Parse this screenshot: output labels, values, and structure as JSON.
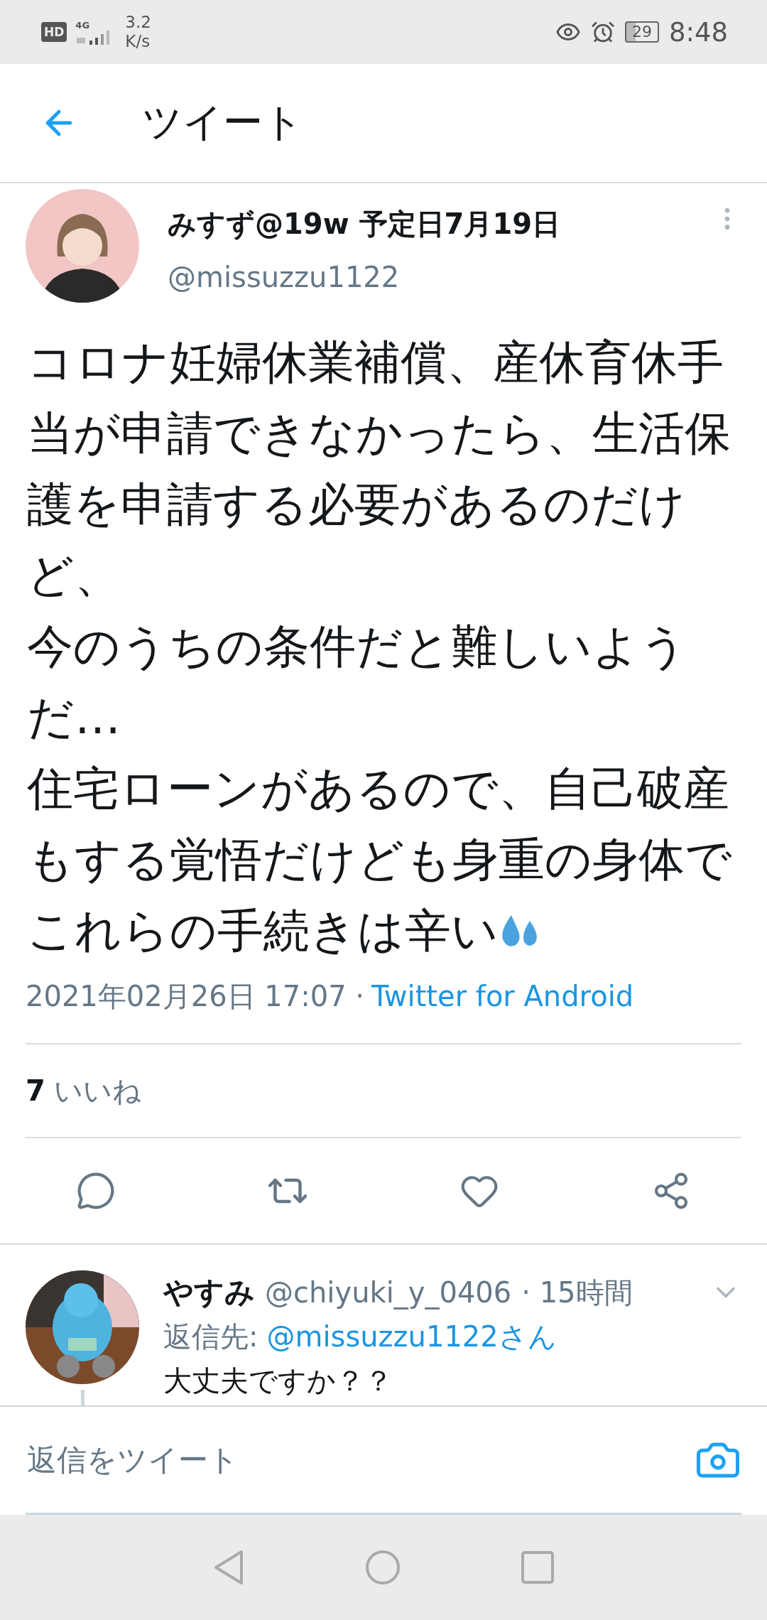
{
  "status_bar": {
    "network_badge": "HD",
    "network_type": "4G",
    "speed_value": "3.2",
    "speed_unit": "K/s",
    "battery": "29",
    "time": "8:48"
  },
  "header": {
    "title": "ツイート"
  },
  "tweet": {
    "author": {
      "name": "みすず@19w 予定日7月19日",
      "handle": "@missuzzu1122"
    },
    "paragraphs": [
      "コロナ妊婦休業補償、産休育休手当が申請できなかったら、生活保護を申請する必要があるのだけど、",
      "今のうちの条件だと難しいようだ…",
      "住宅ローンがあるので、自己破産もする覚悟だけども身重の身体でこれらの手続きは辛い"
    ],
    "timestamp": "2021年02月26日 17:07 ·",
    "source": "Twitter for Android",
    "likes": {
      "count": "7",
      "label": "いいね"
    },
    "liked": false
  },
  "reply": {
    "name": "やすみ",
    "handle": "@chiyuki_y_0406",
    "time": "· 15時間",
    "reply_to_label": "返信先:",
    "reply_to": "@missuzzu1122さん",
    "text": "大丈夫ですか？？"
  },
  "compose": {
    "placeholder": "返信をツイート"
  }
}
